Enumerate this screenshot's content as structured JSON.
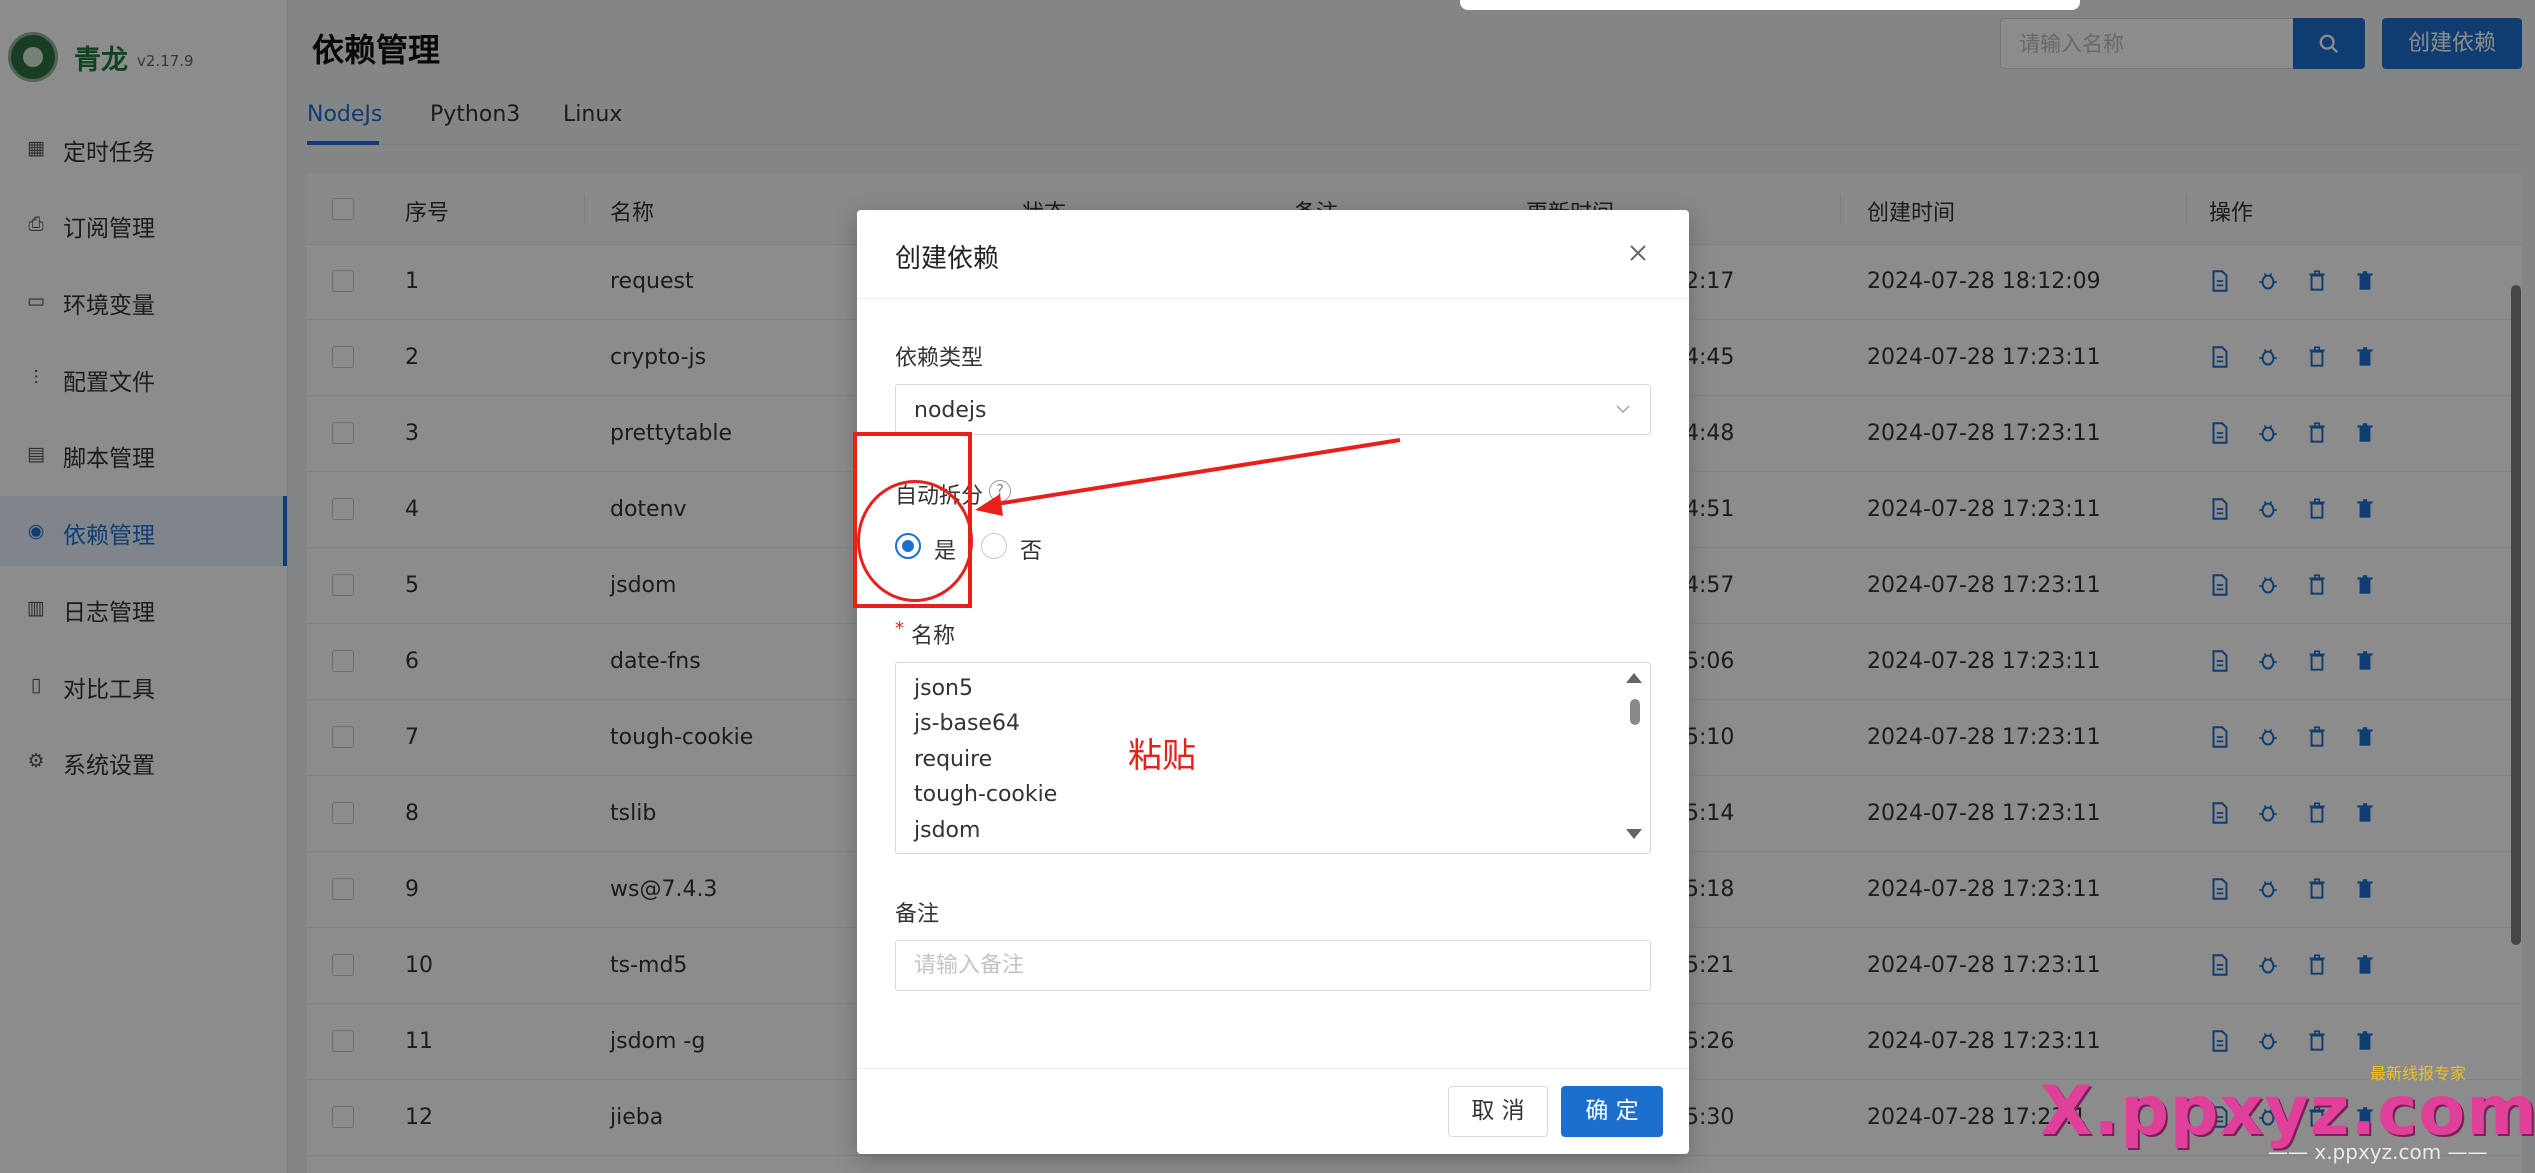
{
  "app": {
    "name": "青龙",
    "version": "v2.17.9"
  },
  "sidebar": {
    "items": [
      {
        "label": "定时任务",
        "icon": "calendar-icon",
        "active": false
      },
      {
        "label": "订阅管理",
        "icon": "subscription-icon",
        "active": false
      },
      {
        "label": "环境变量",
        "icon": "monitor-icon",
        "active": false
      },
      {
        "label": "配置文件",
        "icon": "sliders-icon",
        "active": false
      },
      {
        "label": "脚本管理",
        "icon": "script-icon",
        "active": false
      },
      {
        "label": "依赖管理",
        "icon": "dependency-icon",
        "active": true
      },
      {
        "label": "日志管理",
        "icon": "log-icon",
        "active": false
      },
      {
        "label": "对比工具",
        "icon": "diff-icon",
        "active": false
      },
      {
        "label": "系统设置",
        "icon": "gear-icon",
        "active": false
      }
    ]
  },
  "header": {
    "title": "依赖管理",
    "search_placeholder": "请输入名称",
    "create_label": "创建依赖"
  },
  "tabs": [
    {
      "label": "NodeJs",
      "active": true
    },
    {
      "label": "Python3",
      "active": false
    },
    {
      "label": "Linux",
      "active": false
    }
  ],
  "table": {
    "columns": [
      "序号",
      "名称",
      "状态",
      "备注",
      "更新时间",
      "创建时间",
      "操作"
    ],
    "rows": [
      {
        "index": "1",
        "name": "request",
        "updated": "2:17",
        "created": "2024-07-28 18:12:09"
      },
      {
        "index": "2",
        "name": "crypto-js",
        "updated": "4:45",
        "created": "2024-07-28 17:23:11"
      },
      {
        "index": "3",
        "name": "prettytable",
        "updated": "4:48",
        "created": "2024-07-28 17:23:11"
      },
      {
        "index": "4",
        "name": "dotenv",
        "updated": "4:51",
        "created": "2024-07-28 17:23:11"
      },
      {
        "index": "5",
        "name": "jsdom",
        "updated": "4:57",
        "created": "2024-07-28 17:23:11"
      },
      {
        "index": "6",
        "name": "date-fns",
        "updated": "5:06",
        "created": "2024-07-28 17:23:11"
      },
      {
        "index": "7",
        "name": "tough-cookie",
        "updated": "5:10",
        "created": "2024-07-28 17:23:11"
      },
      {
        "index": "8",
        "name": "tslib",
        "updated": "5:14",
        "created": "2024-07-28 17:23:11"
      },
      {
        "index": "9",
        "name": "ws@7.4.3",
        "updated": "5:18",
        "created": "2024-07-28 17:23:11"
      },
      {
        "index": "10",
        "name": "ts-md5",
        "updated": "5:21",
        "created": "2024-07-28 17:23:11"
      },
      {
        "index": "11",
        "name": "jsdom -g",
        "updated": "5:26",
        "created": "2024-07-28 17:23:11"
      },
      {
        "index": "12",
        "name": "jieba",
        "updated": "5:30",
        "created": "2024-07-28 17:23:1"
      }
    ]
  },
  "modal": {
    "title": "创建依赖",
    "type_label": "依赖类型",
    "type_value": "nodejs",
    "auto_split_label": "自动拆分",
    "help_glyph": "?",
    "yes_label": "是",
    "no_label": "否",
    "required_mark": "*",
    "name_label": "名称",
    "name_lines": [
      "json5",
      "js-base64",
      "require",
      "tough-cookie",
      "jsdom"
    ],
    "remark_label": "备注",
    "remark_placeholder": "请输入备注",
    "cancel_label": "取 消",
    "ok_label": "确 定"
  },
  "annotation": {
    "text": "粘贴",
    "color": "#e8201c"
  },
  "watermark": {
    "main": "X.ppxyz.com",
    "small": "最新线报专家",
    "sub": "—— x.ppxyz.com ——"
  },
  "colors": {
    "primary": "#1d6fce",
    "brand_green": "#1e7a3e"
  }
}
